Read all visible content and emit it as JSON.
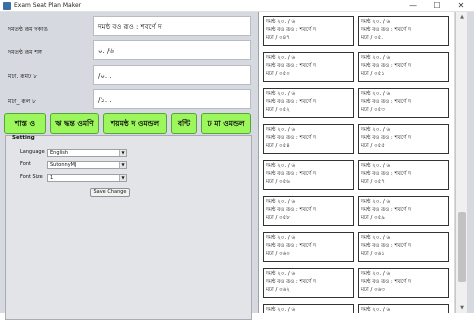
{
  "window": {
    "title": "Exam Seat Plan Maker",
    "minimize": "—",
    "maximize": "☐",
    "close": "✕"
  },
  "form": {
    "fields": [
      {
        "label": "দমতন্ঠ রূম দকাঙ",
        "value": "দমন্ঠ বও রূও : শবর্ণে দ"
      },
      {
        "label": "দমতন্ঠ রূম শঙ্গ",
        "value": "০. /৬"
      },
      {
        "label": "মঢা. রূমঢ ৮",
        "value": "/০. ."
      },
      {
        "label": "মঢা_ রূল ৮",
        "value": "/১. ."
      }
    ]
  },
  "buttons": [
    {
      "label": "শাস্ত ও"
    },
    {
      "label": "ঋ দ্ধন্ত ওমণি"
    },
    {
      "label": "শয়মন্ঠ দ ওমন্ডল"
    },
    {
      "label": "বন্টি"
    },
    {
      "label": "ঢ মা ওমন্ডল"
    }
  ],
  "settings": {
    "title": "Setting",
    "language_label": "Language",
    "language_value": "English",
    "font_label": "Font",
    "font_value": "SutonnyMJ",
    "font_size_label": "Font Size",
    "font_size_value": "1",
    "save_label": "Save Change"
  },
  "seats": [
    {
      "l1": "দমন্ঠ ২০. / ৬",
      "l2": "দমন্ঠ বও রূও : শবর্ণে দ",
      "l3": "মঢা / ০৪৭"
    },
    {
      "l1": "দমন্ঠ ২০. / ৬",
      "l2": "দমন্ঠ বও রূও : শবর্ণে দ",
      "l3": "মঢা / ০৫."
    },
    {
      "l1": "দমন্ঠ ২০. / ৬",
      "l2": "দমন্ঠ বও রূও : শবর্ণে দ",
      "l3": "মঢা / ০৫০"
    },
    {
      "l1": "দমন্ঠ ২০. / ৬",
      "l2": "দমন্ঠ বও রূও : শবর্ণে দ",
      "l3": "মঢা / ০৫১"
    },
    {
      "l1": "দমন্ঠ ২০. / ৬",
      "l2": "দমন্ঠ বও রূও : শবর্ণে দ",
      "l3": "মঢা / ০৫২"
    },
    {
      "l1": "দমন্ঠ ২০. / ৬",
      "l2": "দমন্ঠ বও রূও : শবর্ণে দ",
      "l3": "মঢা / ০৫৩"
    },
    {
      "l1": "দমন্ঠ ২০. / ৬",
      "l2": "দমন্ঠ বও রূও : শবর্ণে দ",
      "l3": "মঢা / ০৫৪"
    },
    {
      "l1": "দমন্ঠ ২০. / ৬",
      "l2": "দমন্ঠ বও রূও : শবর্ণে দ",
      "l3": "মঢা / ০৫৫"
    },
    {
      "l1": "দমন্ঠ ২০. / ৬",
      "l2": "দমন্ঠ বও রূও : শবর্ণে দ",
      "l3": "মঢা / ০৫৬"
    },
    {
      "l1": "দমন্ঠ ২০. / ৬",
      "l2": "দমন্ঠ বও রূও : শবর্ণে দ",
      "l3": "মঢা / ০৫৭"
    },
    {
      "l1": "দমন্ঠ ২০. / ৬",
      "l2": "দমন্ঠ বও রূও : শবর্ণে দ",
      "l3": "মঢা / ০৫৮"
    },
    {
      "l1": "দমন্ঠ ২০. / ৬",
      "l2": "দমন্ঠ বও রূও : শবর্ণে দ",
      "l3": "মঢা / ০৫৯"
    },
    {
      "l1": "দমন্ঠ ২০. / ৬",
      "l2": "দমন্ঠ বও রূও : শবর্ণে দ",
      "l3": "মঢা / ০৬০"
    },
    {
      "l1": "দমন্ঠ ২০. / ৬",
      "l2": "দমন্ঠ বও রূও : শবর্ণে দ",
      "l3": "মঢা / ০৬১"
    },
    {
      "l1": "দমন্ঠ ২০. / ৬",
      "l2": "দমন্ঠ বও রূও : শবর্ণে দ",
      "l3": "মঢা / ০৬২"
    },
    {
      "l1": "দমন্ঠ ২০. / ৬",
      "l2": "দমন্ঠ বও রূও : শবর্ণে দ",
      "l3": "মঢা / ০৬৩"
    },
    {
      "l1": "দমন্ঠ ২০. / ৬",
      "l2": "দমন্ঠ বও রূও : শবর্ণে দ",
      "l3": "মঢা / ০৬৪"
    },
    {
      "l1": "দমন্ঠ ২০. / ৬",
      "l2": "দমন্ঠ বও রূও : শবর্ণে দ",
      "l3": "মঢা / ০৬৫"
    }
  ],
  "scrollbar": {
    "up": "▲",
    "down": "▼"
  }
}
